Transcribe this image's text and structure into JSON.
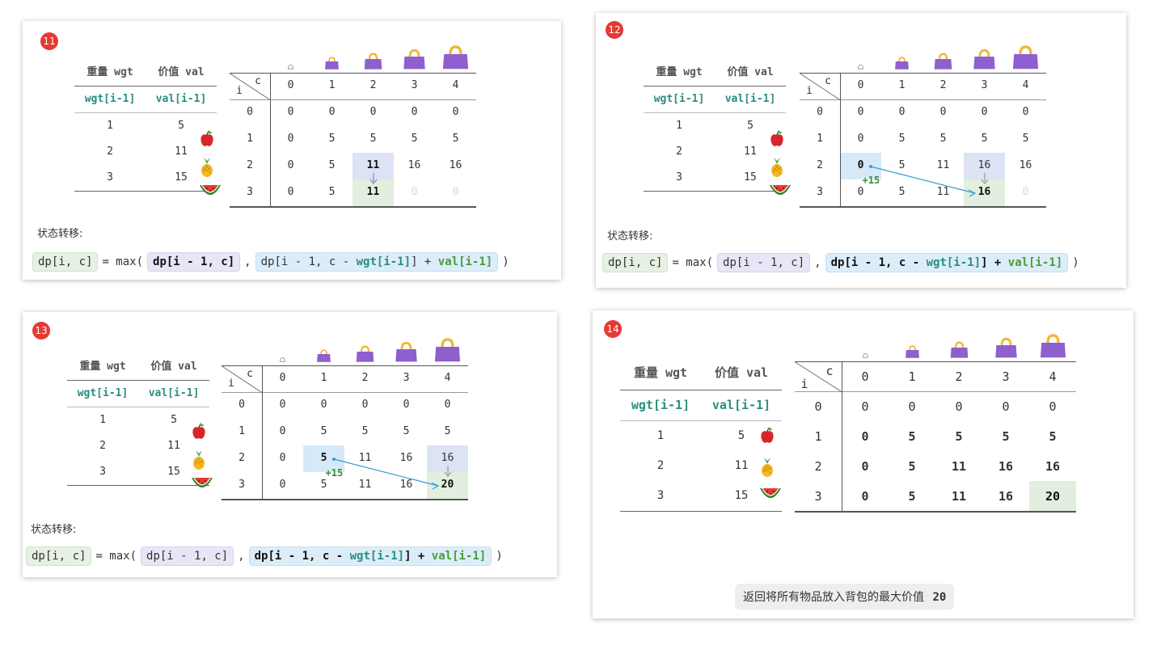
{
  "step_badges": [
    "11",
    "12",
    "13",
    "14"
  ],
  "weights_table": {
    "header": [
      "重量 wgt",
      "价值 val"
    ],
    "subheader": [
      "wgt[i-1]",
      "val[i-1]"
    ],
    "rows": [
      [
        "1",
        "5"
      ],
      [
        "2",
        "11"
      ],
      [
        "3",
        "15"
      ]
    ]
  },
  "grid": {
    "corner_i": "i",
    "corner_c": "c",
    "capacities": [
      "0",
      "1",
      "2",
      "3",
      "4"
    ],
    "row_labels": [
      "0",
      "1",
      "2",
      "3"
    ]
  },
  "panels": [
    {
      "rows": [
        [
          "0",
          "0",
          "0",
          "0",
          "0"
        ],
        [
          "0",
          "5",
          "5",
          "5",
          "5"
        ],
        [
          "0",
          "5",
          "11",
          "16",
          "16"
        ],
        [
          "0",
          "5",
          "11",
          "0",
          "0"
        ]
      ]
    },
    {
      "rows": [
        [
          "0",
          "0",
          "0",
          "0",
          "0"
        ],
        [
          "0",
          "5",
          "5",
          "5",
          "5"
        ],
        [
          "0",
          "5",
          "11",
          "16",
          "16"
        ],
        [
          "0",
          "5",
          "11",
          "16",
          "0"
        ]
      ],
      "plus": "+15"
    },
    {
      "rows": [
        [
          "0",
          "0",
          "0",
          "0",
          "0"
        ],
        [
          "0",
          "5",
          "5",
          "5",
          "5"
        ],
        [
          "0",
          "5",
          "11",
          "16",
          "16"
        ],
        [
          "0",
          "5",
          "11",
          "16",
          "20"
        ]
      ],
      "plus": "+15"
    },
    {
      "rows": [
        [
          "0",
          "0",
          "0",
          "0",
          "0"
        ],
        [
          "0",
          "5",
          "5",
          "5",
          "5"
        ],
        [
          "0",
          "5",
          "11",
          "16",
          "16"
        ],
        [
          "0",
          "5",
          "11",
          "16",
          "20"
        ]
      ]
    }
  ],
  "state_label": "状态转移:",
  "formula": {
    "lhs": "dp[i, c]",
    "eq_max": "= max(",
    "opt1": "dp[i - 1, c]",
    "comma": ",",
    "opt2_a": "dp[i - 1, c - ",
    "opt2_wgt": "wgt[i-1]",
    "opt2_b": "] + ",
    "opt2_val": "val[i-1]",
    "close": ")"
  },
  "final_text": "返回将所有物品放入背包的最大价值",
  "final_value": "20",
  "icons": {
    "fruits": [
      "apple-icon",
      "pineapple-icon",
      "watermelon-icon"
    ],
    "bags": [
      "bag-size-0-icon",
      "bag-size-1-icon",
      "bag-size-2-icon",
      "bag-size-3-icon",
      "bag-size-4-icon"
    ]
  },
  "colors": {
    "badge": "#e53935",
    "highlight_blue": "#dde3f5",
    "highlight_light_blue": "#d6e9f8",
    "highlight_green": "#e2efdf",
    "teal_text": "#2a8d7e",
    "bag_purple": "#8e5fcf",
    "bag_handle": "#f2b63a"
  }
}
